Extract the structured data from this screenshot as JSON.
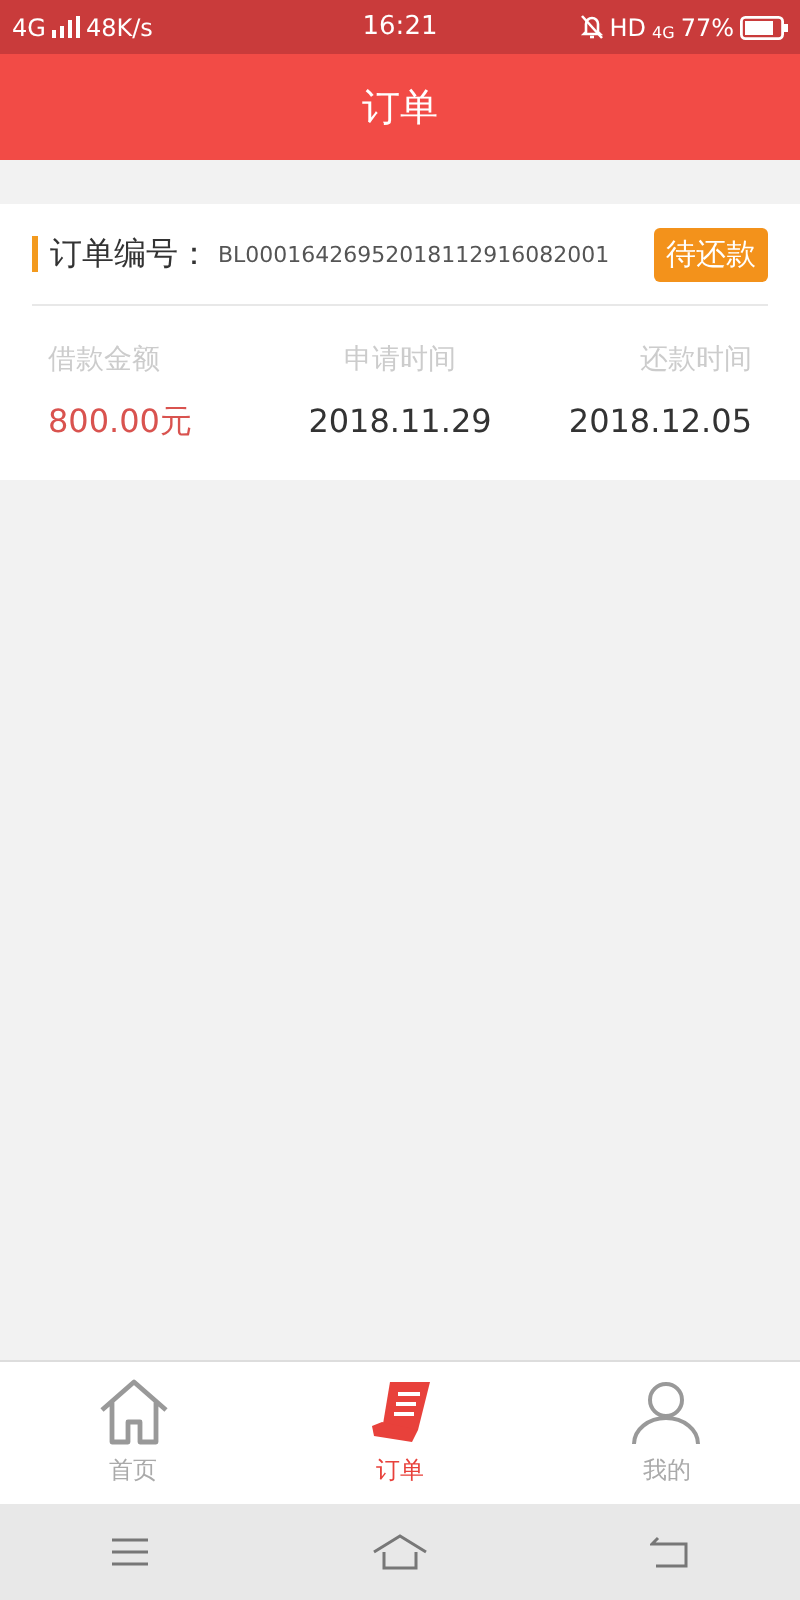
{
  "status_bar": {
    "network": "4G",
    "speed": "48K/s",
    "time": "16:21",
    "hd": "HD",
    "network_2": "4G",
    "battery": "77%"
  },
  "header": {
    "title": "订单"
  },
  "order": {
    "number_label": "订单编号：",
    "number": "BL00016426952018112916082001",
    "status": "待还款",
    "fields": [
      {
        "label": "借款金额",
        "value": "800.00元",
        "kind": "amount"
      },
      {
        "label": "申请时间",
        "value": "2018.11.29",
        "kind": "date"
      },
      {
        "label": "还款时间",
        "value": "2018.12.05",
        "kind": "date"
      }
    ]
  },
  "tabs": [
    {
      "label": "首页",
      "selected": false,
      "kind": "home"
    },
    {
      "label": "订单",
      "selected": true,
      "kind": "orders"
    },
    {
      "label": "我的",
      "selected": false,
      "kind": "profile"
    }
  ]
}
